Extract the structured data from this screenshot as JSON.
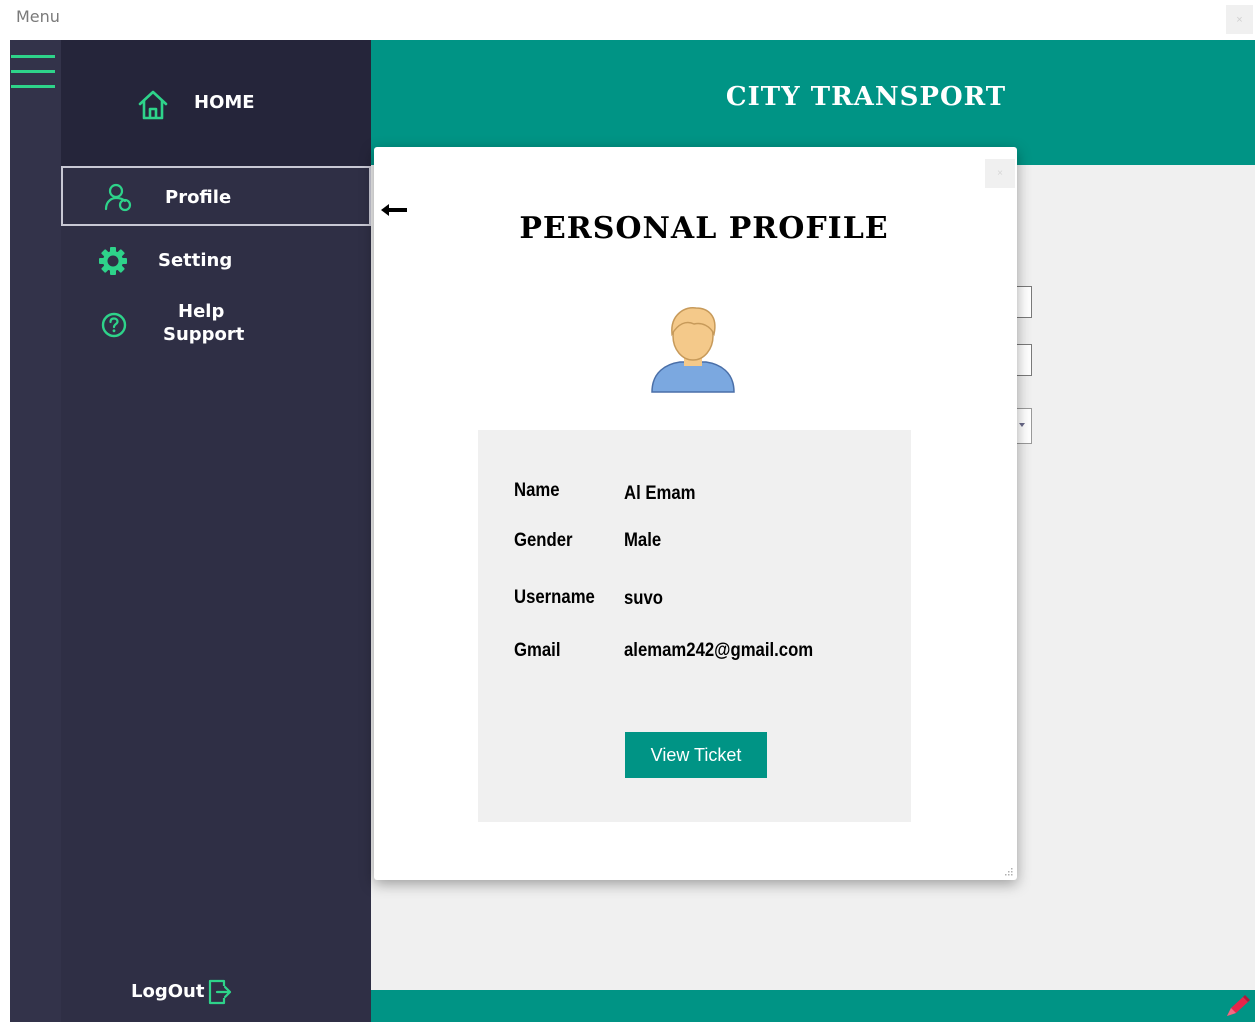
{
  "window": {
    "title": "Menu",
    "close_glyph": "×"
  },
  "app": {
    "title": "CITY TRANSPORT",
    "accent_color": "#009485",
    "nav_icon_color": "#2ed38a"
  },
  "sidebar": {
    "home_label": "HOME",
    "items": [
      {
        "label": "Profile",
        "icon": "profile-icon",
        "active": true
      },
      {
        "label": "Setting",
        "icon": "gear-icon",
        "active": false
      },
      {
        "label_line1": "Help",
        "label_line2": "Support",
        "icon": "help-icon",
        "active": false
      }
    ],
    "logout_label": "LogOut"
  },
  "profile_modal": {
    "title": "PERSONAL PROFILE",
    "close_glyph": "×",
    "fields": [
      {
        "label": "Name",
        "value": "Al Emam"
      },
      {
        "label": "Gender",
        "value": "Male"
      },
      {
        "label": "Username",
        "value": "suvo"
      },
      {
        "label": "Gmail",
        "value": "alemam242@gmail.com"
      }
    ],
    "view_ticket_label": "View Ticket"
  }
}
